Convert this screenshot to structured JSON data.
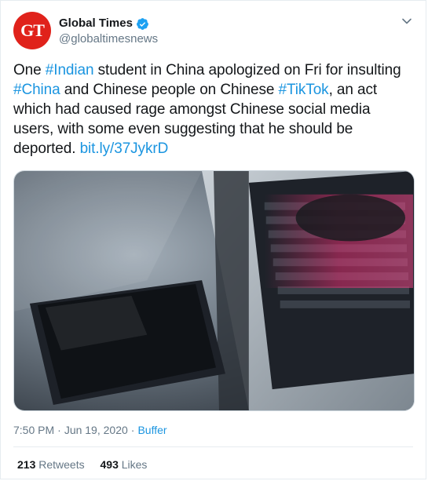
{
  "account": {
    "avatar_text": "GT",
    "display_name": "Global Times",
    "handle": "@globaltimesnews",
    "verified": true
  },
  "tweet": {
    "segments": [
      {
        "text": "One ",
        "type": "text"
      },
      {
        "text": "#Indian",
        "type": "hashtag"
      },
      {
        "text": " student in China apologized on Fri for insulting ",
        "type": "text"
      },
      {
        "text": "#China",
        "type": "hashtag"
      },
      {
        "text": " and Chinese people on Chinese ",
        "type": "text"
      },
      {
        "text": "#TikTok",
        "type": "hashtag"
      },
      {
        "text": ", an act which had caused rage amongst Chinese social media users, with some even suggesting that he should be deported. ",
        "type": "text"
      },
      {
        "text": "bit.ly/37JykrD",
        "type": "link"
      }
    ],
    "media": {
      "description": "photo",
      "colors": {
        "background": "#4b5560",
        "keyboard_glow": "#ff2f7a"
      }
    },
    "time": "7:50 PM",
    "date": "Jun 19, 2020",
    "separator": "·",
    "source": "Buffer",
    "retweets_count": "213",
    "retweets_label": "Retweets",
    "likes_count": "493",
    "likes_label": "Likes"
  },
  "icons": {
    "verified": "verified-badge-icon",
    "caret": "chevron-down-icon"
  },
  "colors": {
    "link": "#1b95e0",
    "brand": "#e0221b",
    "muted": "#657786"
  }
}
